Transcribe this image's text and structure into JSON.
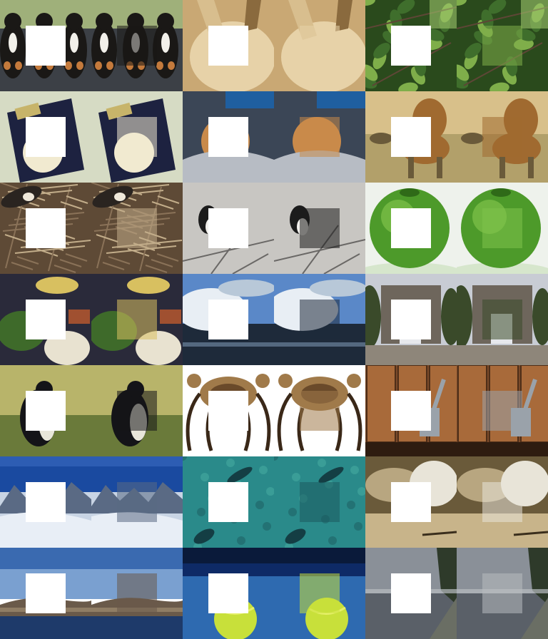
{
  "grid": {
    "rows": 7,
    "cols": 6
  },
  "mask_color": "#ffffff",
  "pairs": [
    {
      "subject": "dogs",
      "colors": [
        "#3c4046",
        "#9fb07a",
        "#1a1816",
        "#c47a3c",
        "#f2f0ea"
      ],
      "motif": "dogs"
    },
    {
      "subject": "rabbit",
      "colors": [
        "#c9a874",
        "#a38454",
        "#e7d2a8",
        "#8a6a3e",
        "#d8be8e"
      ],
      "motif": "blob"
    },
    {
      "subject": "bird-in-tree",
      "colors": [
        "#3f6e2c",
        "#2a4a1c",
        "#7fae4a",
        "#5e4636",
        "#9cc46a"
      ],
      "motif": "leaves"
    },
    {
      "subject": "book-cd",
      "colors": [
        "#d6dbc4",
        "#1d2240",
        "#f1ead0",
        "#8a8f6a",
        "#c7b46a"
      ],
      "motif": "book"
    },
    {
      "subject": "cat-on-couch",
      "colors": [
        "#5a6a80",
        "#3b4656",
        "#c98a4a",
        "#b7bcc4",
        "#1f5fa0"
      ],
      "motif": "cat"
    },
    {
      "subject": "lion",
      "colors": [
        "#b2a06a",
        "#8a7a4a",
        "#a06a30",
        "#d8c08a",
        "#6a5a3a"
      ],
      "motif": "lion"
    },
    {
      "subject": "bird-on-straw",
      "colors": [
        "#8a7258",
        "#5e4a36",
        "#c2ad8a",
        "#2a2420",
        "#efe8da"
      ],
      "motif": "straw"
    },
    {
      "subject": "bird-on-branch",
      "colors": [
        "#c8c6c2",
        "#9e9c98",
        "#1c1c1c",
        "#f2f0ec",
        "#6a6866"
      ],
      "motif": "perch"
    },
    {
      "subject": "green-apple",
      "colors": [
        "#eef2ec",
        "#4d9a2a",
        "#7fc24a",
        "#2f6a18",
        "#d6e6cc"
      ],
      "motif": "apple"
    },
    {
      "subject": "food-spread",
      "colors": [
        "#2a2a3a",
        "#3e6a2a",
        "#d8c060",
        "#a05030",
        "#e8e2d0"
      ],
      "motif": "food"
    },
    {
      "subject": "wave",
      "colors": [
        "#5a88c8",
        "#e8eef4",
        "#1e2a3a",
        "#8aa6c4",
        "#b8c8d8"
      ],
      "motif": "wave"
    },
    {
      "subject": "stone-arch",
      "colors": [
        "#c8ccd4",
        "#6e665c",
        "#3a4a2a",
        "#8e867a",
        "#e6e8ec"
      ],
      "motif": "arch"
    },
    {
      "subject": "penguin",
      "colors": [
        "#b8b46a",
        "#8a8a4a",
        "#141418",
        "#e8e6da",
        "#6a7a3a"
      ],
      "motif": "penguin"
    },
    {
      "subject": "crab",
      "colors": [
        "#ffffff",
        "#6a4a2a",
        "#a07a4a",
        "#3a2818",
        "#d8c8a8"
      ],
      "motif": "crab"
    },
    {
      "subject": "mortar-pestle",
      "colors": [
        "#7a4a2a",
        "#4e2e18",
        "#9aa2aa",
        "#a86a3a",
        "#2e1c10"
      ],
      "motif": "wood"
    },
    {
      "subject": "snowy-mountains",
      "colors": [
        "#1a4aa0",
        "#e8eef6",
        "#5a6a84",
        "#c8d4e4",
        "#3a6ac0"
      ],
      "motif": "mountains"
    },
    {
      "subject": "fish-underwater",
      "colors": [
        "#2a8a8a",
        "#4ab0a4",
        "#1c5a5e",
        "#7ac8bc",
        "#143e44"
      ],
      "motif": "fish"
    },
    {
      "subject": "bowl-and-glass",
      "colors": [
        "#6a5a3a",
        "#b8a680",
        "#e8e4d8",
        "#3a2e1c",
        "#c8b48a"
      ],
      "motif": "bowls"
    },
    {
      "subject": "breakwater",
      "colors": [
        "#3a6ab0",
        "#7aa0d0",
        "#6a5a4a",
        "#1e3a6a",
        "#a89478"
      ],
      "motif": "breakwater"
    },
    {
      "subject": "tennis-ball",
      "colors": [
        "#0e2a66",
        "#2e6ab0",
        "#c8e03a",
        "#0a1a3a",
        "#e6f06a"
      ],
      "motif": "ball"
    },
    {
      "subject": "lake-pier",
      "colors": [
        "#8a9098",
        "#5a6068",
        "#b8bcc0",
        "#2e3a2a",
        "#6a6e64"
      ],
      "motif": "lake"
    }
  ]
}
